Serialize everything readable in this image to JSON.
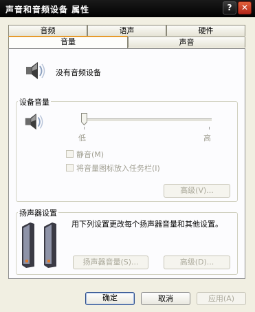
{
  "window": {
    "title": "声音和音频设备 属性",
    "help_glyph": "?",
    "close_glyph": "✕"
  },
  "tabs_row1": [
    "音频",
    "语声",
    "硬件"
  ],
  "tabs_row2": [
    "音量",
    "声音"
  ],
  "selected_tab": "音量",
  "device": {
    "icon": "speaker-icon",
    "status_text": "没有音频设备"
  },
  "device_volume": {
    "group_title": "设备音量",
    "low_label": "低",
    "high_label": "高",
    "volume_level": 0,
    "mute_label": "静音(M)",
    "tray_icon_label": "将音量图标放入任务栏(I)",
    "advanced_button": "高级(V)..."
  },
  "speaker_settings": {
    "group_title": "扬声器设置",
    "description": "用下列设置更改每个扬声器音量和其他设置。",
    "speaker_volume_button": "扬声器音量(S)...",
    "advanced_button": "高级(D)..."
  },
  "dialog_buttons": {
    "ok": "确定",
    "cancel": "取消",
    "apply": "应用(A)"
  }
}
